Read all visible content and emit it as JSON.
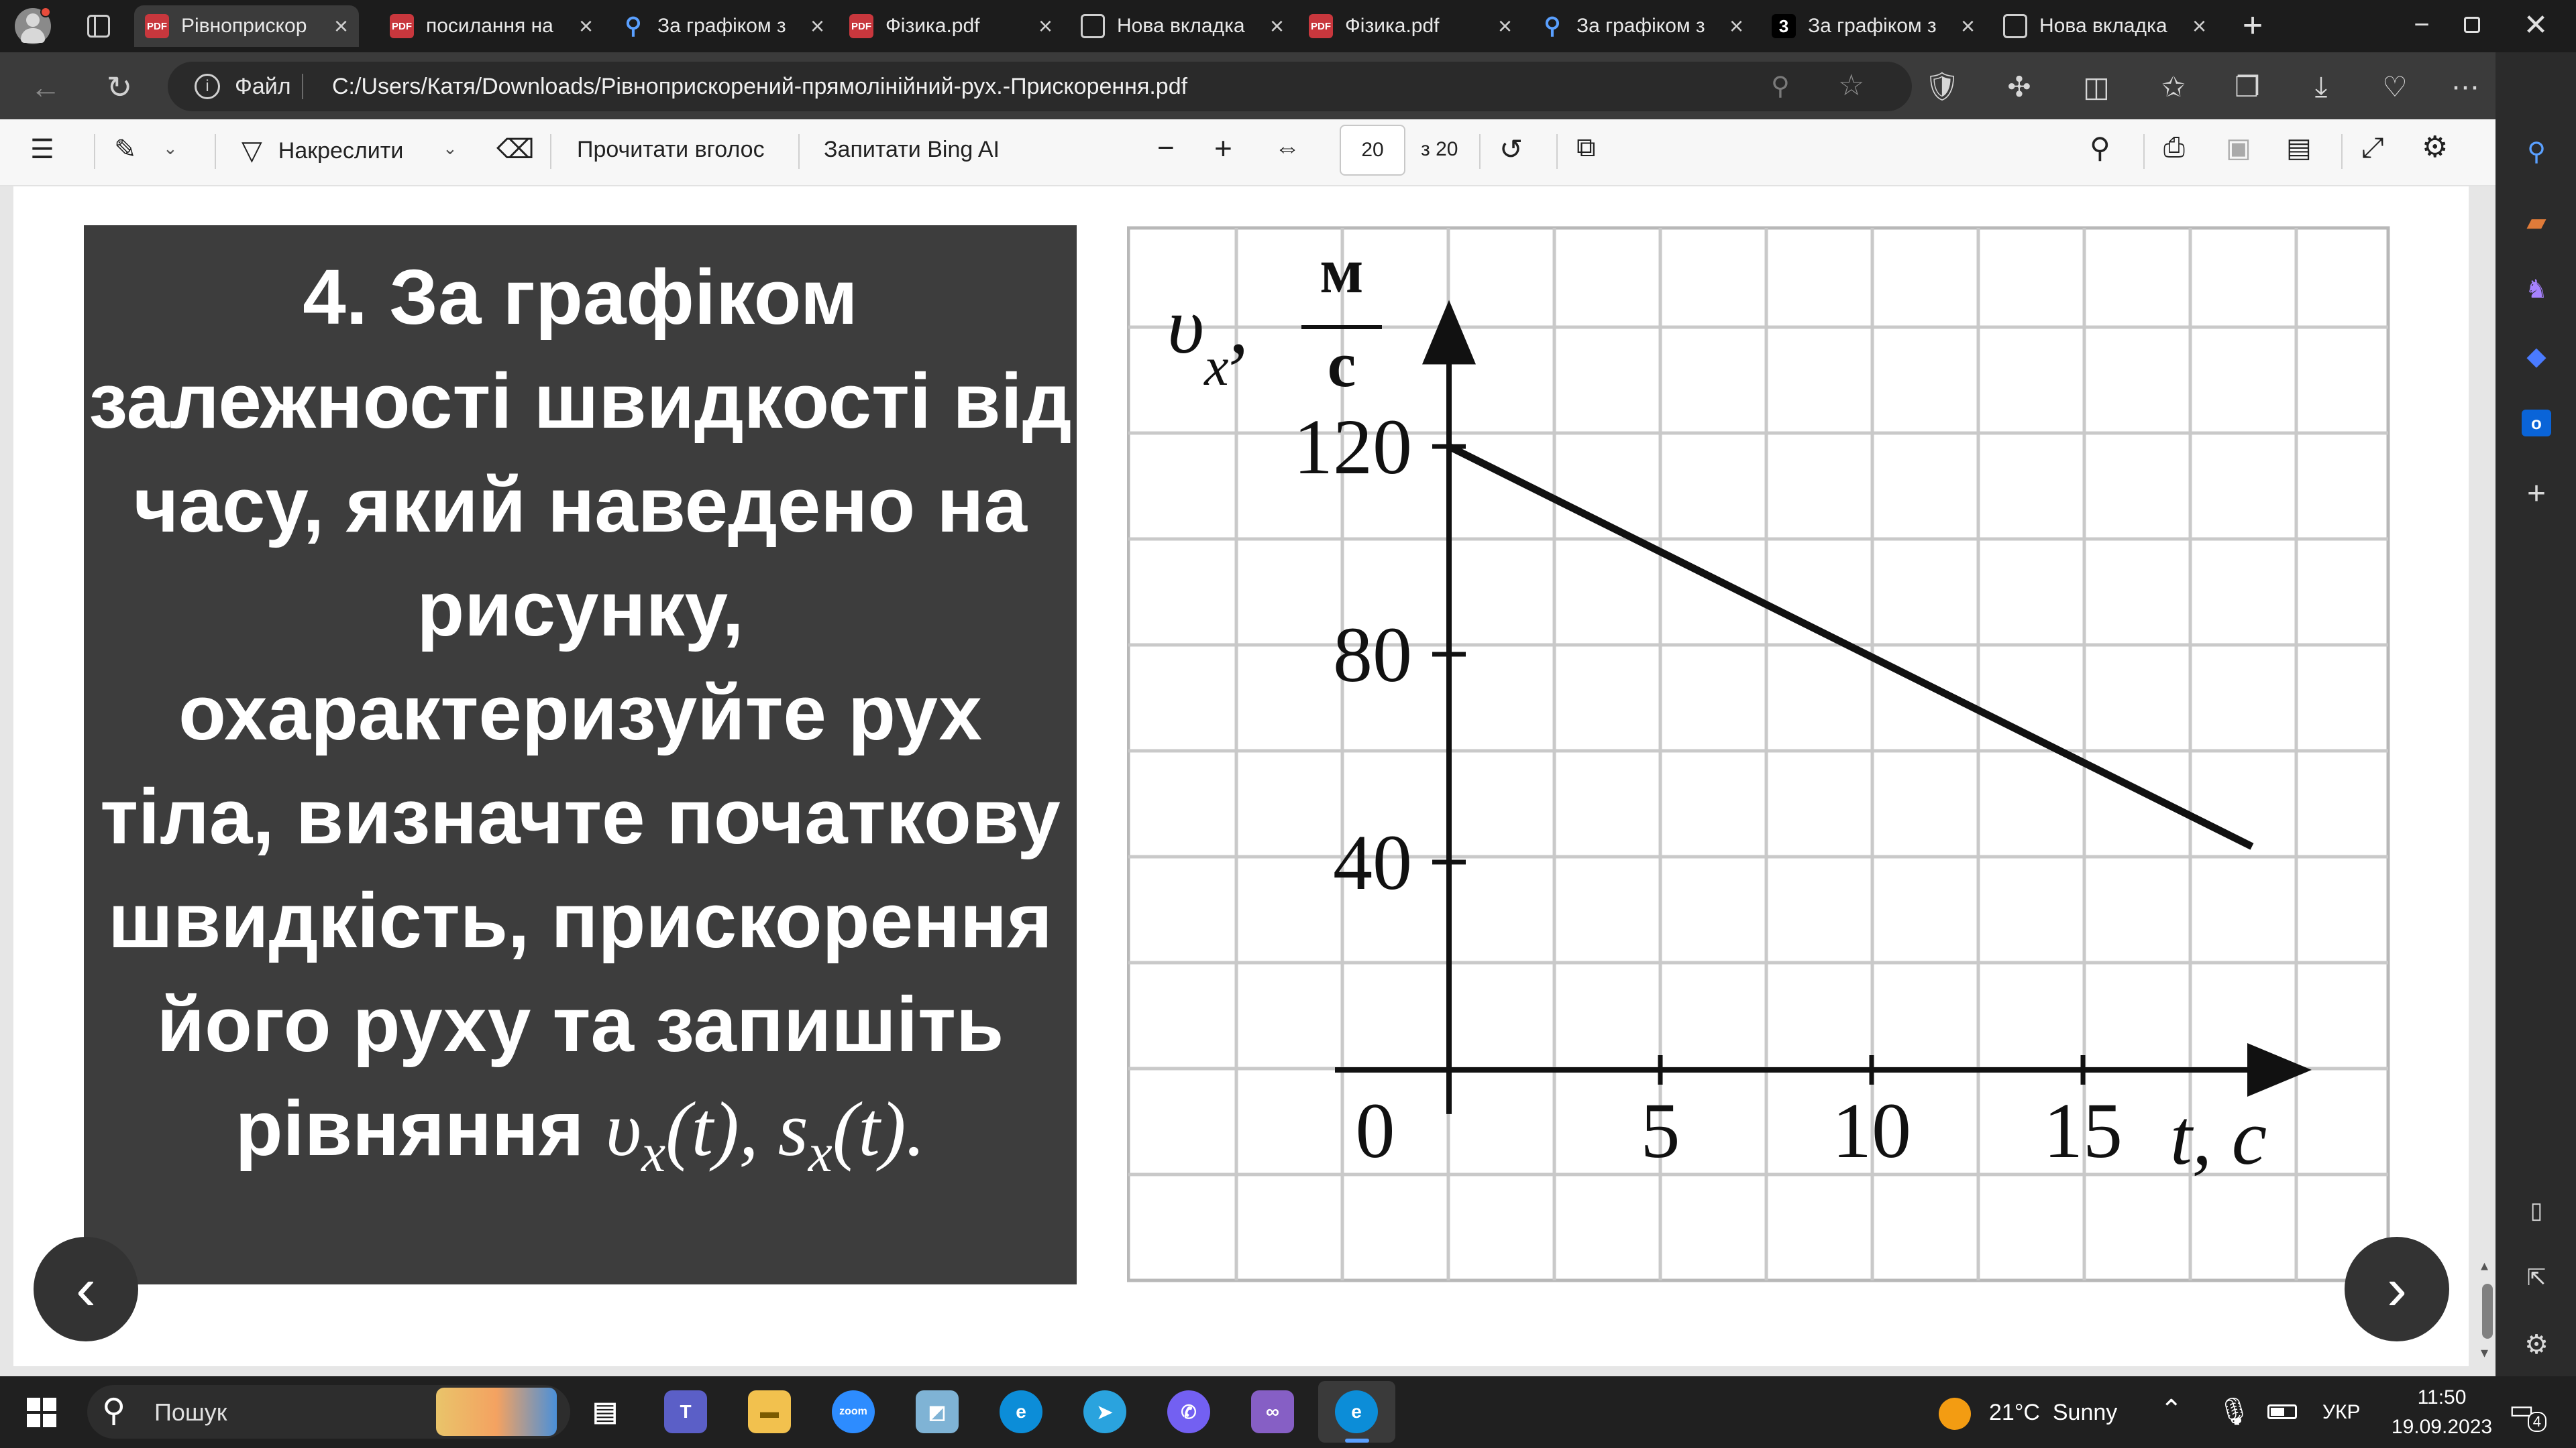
{
  "tabs": [
    {
      "label": "Рівноприскор",
      "icon": "pdf-icon",
      "active": true
    },
    {
      "label": "посилання на",
      "icon": "pdf-icon",
      "active": false
    },
    {
      "label": "За графіком з",
      "icon": "search-icon",
      "active": false
    },
    {
      "label": "Фізика.pdf",
      "icon": "pdf-icon",
      "active": false
    },
    {
      "label": "Нова вкладка",
      "icon": "new-tab-icon",
      "active": false
    },
    {
      "label": "Фізика.pdf",
      "icon": "pdf-icon",
      "active": false
    },
    {
      "label": "За графіком з",
      "icon": "search-icon",
      "active": false
    },
    {
      "label": "За графіком з",
      "icon": "number-icon",
      "badge": "3",
      "active": false
    },
    {
      "label": "Нова вкладка",
      "icon": "new-tab-icon",
      "active": false
    }
  ],
  "pdf_badge": "PDF",
  "address": {
    "scheme_label": "Файл",
    "url": "C:/Users/Катя/Downloads/Рівноприскорений-прямолінійний-рух.-Прискорення.pdf"
  },
  "pdf_toolbar": {
    "draw_label": "Накреслити",
    "read_aloud_label": "Прочитати вголос",
    "ask_bing_label": "Запитати Bing AI",
    "page_current": "20",
    "page_total": "з 20"
  },
  "problem": {
    "text": "4. За графіком залежності швидкості від часу, який наведено на рисунку, охарактеризуйте рух тіла, визначте початкову швидкість, прискорення його руху та запишіть рівняння",
    "eq_v": "υ",
    "eq_sub": "x",
    "eq_arg": "(t),",
    "eq_s": "s",
    "eq_sub2": "x",
    "eq_arg2": "(t)."
  },
  "chart_data": {
    "type": "line",
    "ylabel_var": "υ",
    "ylabel_sub": "x",
    "ylabel_comma": ",",
    "ylabel_num": "м",
    "ylabel_den": "с",
    "xlabel": "t, с",
    "origin_label": "0",
    "x_ticks": [
      5,
      10,
      15
    ],
    "x_tick_labels": [
      "5",
      "10",
      "15"
    ],
    "y_ticks": [
      40,
      80,
      120
    ],
    "y_tick_labels": [
      "40",
      "80",
      "120"
    ],
    "xlim": [
      0,
      20
    ],
    "ylim": [
      0,
      150
    ],
    "grid": true,
    "series": [
      {
        "x": [
          0,
          19
        ],
        "y": [
          120,
          43
        ]
      }
    ]
  },
  "taskbar": {
    "search_label": "Пошук",
    "weather": "21°C  Sunny",
    "language": "УКР",
    "time": "11:50",
    "date": "19.09.2023",
    "notifications": "4",
    "zoom_label": "zoom"
  },
  "colors": {
    "tab_bg": "#1c1c1c",
    "active_tab": "#3b3b3b",
    "panel_bg": "#3d3d3d",
    "pdf_icon": "#c8373d",
    "edge_blue": "#0a84ff"
  }
}
